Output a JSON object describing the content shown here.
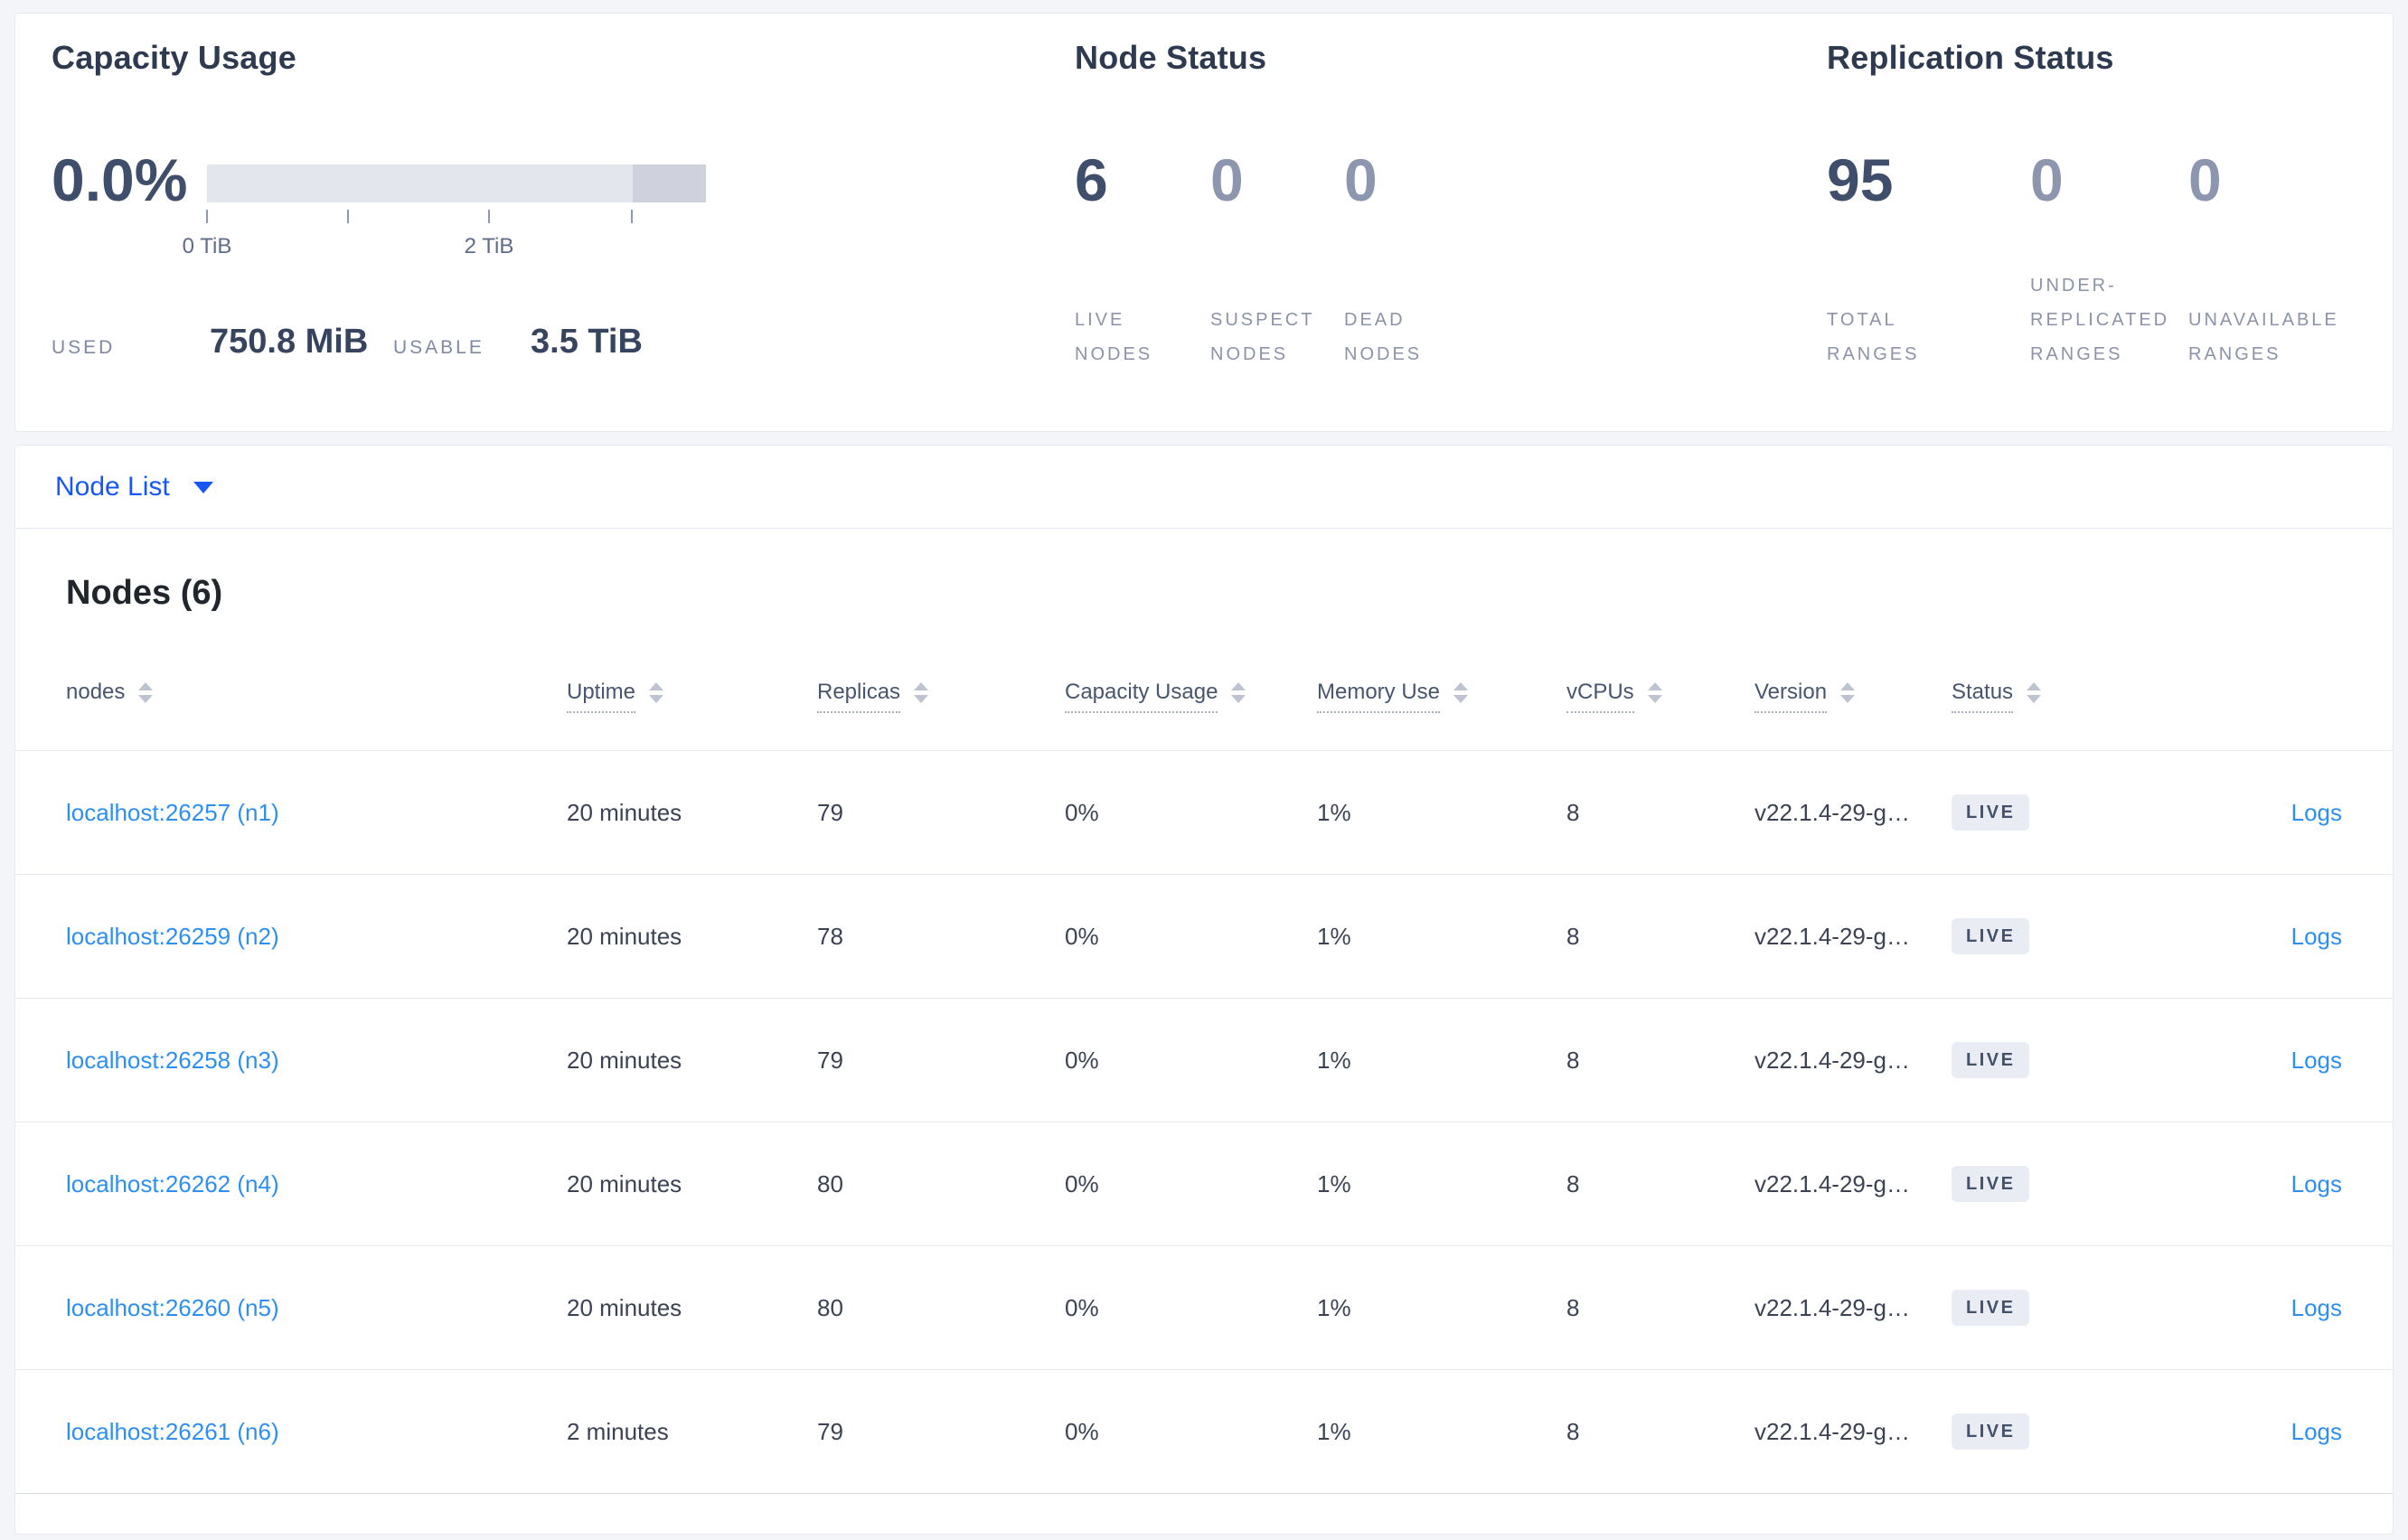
{
  "summary": {
    "capacity": {
      "title": "Capacity Usage",
      "percent": "0.0%",
      "axis_ticks": [
        "0 TiB",
        "2 TiB"
      ],
      "used_label": "USED",
      "used_value": "750.8 MiB",
      "usable_label": "USABLE",
      "usable_value": "3.5 TiB"
    },
    "node_status": {
      "title": "Node Status",
      "stats": [
        {
          "value": "6",
          "emphasis": "dark",
          "label_lines": [
            "LIVE",
            "NODES"
          ]
        },
        {
          "value": "0",
          "emphasis": "light",
          "label_lines": [
            "SUSPECT",
            "NODES"
          ]
        },
        {
          "value": "0",
          "emphasis": "light",
          "label_lines": [
            "DEAD",
            "NODES"
          ]
        }
      ]
    },
    "replication_status": {
      "title": "Replication Status",
      "stats": [
        {
          "value": "95",
          "emphasis": "dark",
          "label_lines": [
            "TOTAL",
            "RANGES"
          ]
        },
        {
          "value": "0",
          "emphasis": "light",
          "label_lines": [
            "UNDER-",
            "REPLICATED",
            "RANGES"
          ]
        },
        {
          "value": "0",
          "emphasis": "light",
          "label_lines": [
            "UNAVAILABLE",
            "RANGES"
          ]
        }
      ]
    }
  },
  "node_list": {
    "dropdown_label": "Node List",
    "heading": "Nodes (6)"
  },
  "table": {
    "columns": [
      {
        "key": "node",
        "label": "nodes",
        "underline": false
      },
      {
        "key": "uptime",
        "label": "Uptime",
        "underline": true
      },
      {
        "key": "replicas",
        "label": "Replicas",
        "underline": true
      },
      {
        "key": "capacity",
        "label": "Capacity Usage",
        "underline": true
      },
      {
        "key": "memory",
        "label": "Memory Use",
        "underline": true
      },
      {
        "key": "vcpus",
        "label": "vCPUs",
        "underline": true
      },
      {
        "key": "version",
        "label": "Version",
        "underline": true
      },
      {
        "key": "status",
        "label": "Status",
        "underline": true
      }
    ],
    "rows": [
      {
        "node": "localhost:26257 (n1)",
        "uptime": "20 minutes",
        "replicas": "79",
        "capacity": "0%",
        "memory": "1%",
        "vcpus": "8",
        "version": "v22.1.4-29-g…",
        "status": "LIVE",
        "logs": "Logs"
      },
      {
        "node": "localhost:26259 (n2)",
        "uptime": "20 minutes",
        "replicas": "78",
        "capacity": "0%",
        "memory": "1%",
        "vcpus": "8",
        "version": "v22.1.4-29-g…",
        "status": "LIVE",
        "logs": "Logs"
      },
      {
        "node": "localhost:26258 (n3)",
        "uptime": "20 minutes",
        "replicas": "79",
        "capacity": "0%",
        "memory": "1%",
        "vcpus": "8",
        "version": "v22.1.4-29-g…",
        "status": "LIVE",
        "logs": "Logs"
      },
      {
        "node": "localhost:26262 (n4)",
        "uptime": "20 minutes",
        "replicas": "80",
        "capacity": "0%",
        "memory": "1%",
        "vcpus": "8",
        "version": "v22.1.4-29-g…",
        "status": "LIVE",
        "logs": "Logs"
      },
      {
        "node": "localhost:26260 (n5)",
        "uptime": "20 minutes",
        "replicas": "80",
        "capacity": "0%",
        "memory": "1%",
        "vcpus": "8",
        "version": "v22.1.4-29-g…",
        "status": "LIVE",
        "logs": "Logs"
      },
      {
        "node": "localhost:26261 (n6)",
        "uptime": "2 minutes",
        "replicas": "79",
        "capacity": "0%",
        "memory": "1%",
        "vcpus": "8",
        "version": "v22.1.4-29-g…",
        "status": "LIVE",
        "logs": "Logs"
      }
    ]
  },
  "colors": {
    "page_background": "#f4f5f9",
    "card_border": "#e7e9f0",
    "dark_stat": "#3f4e6a",
    "light_stat": "#8d96af",
    "gauge_track": "#e4e6ed",
    "gauge_segment": "#cfd2dd",
    "dropdown_blue": "#1657f5",
    "link_blue": "#2e8ff2",
    "badge_background": "#e9edf3"
  }
}
